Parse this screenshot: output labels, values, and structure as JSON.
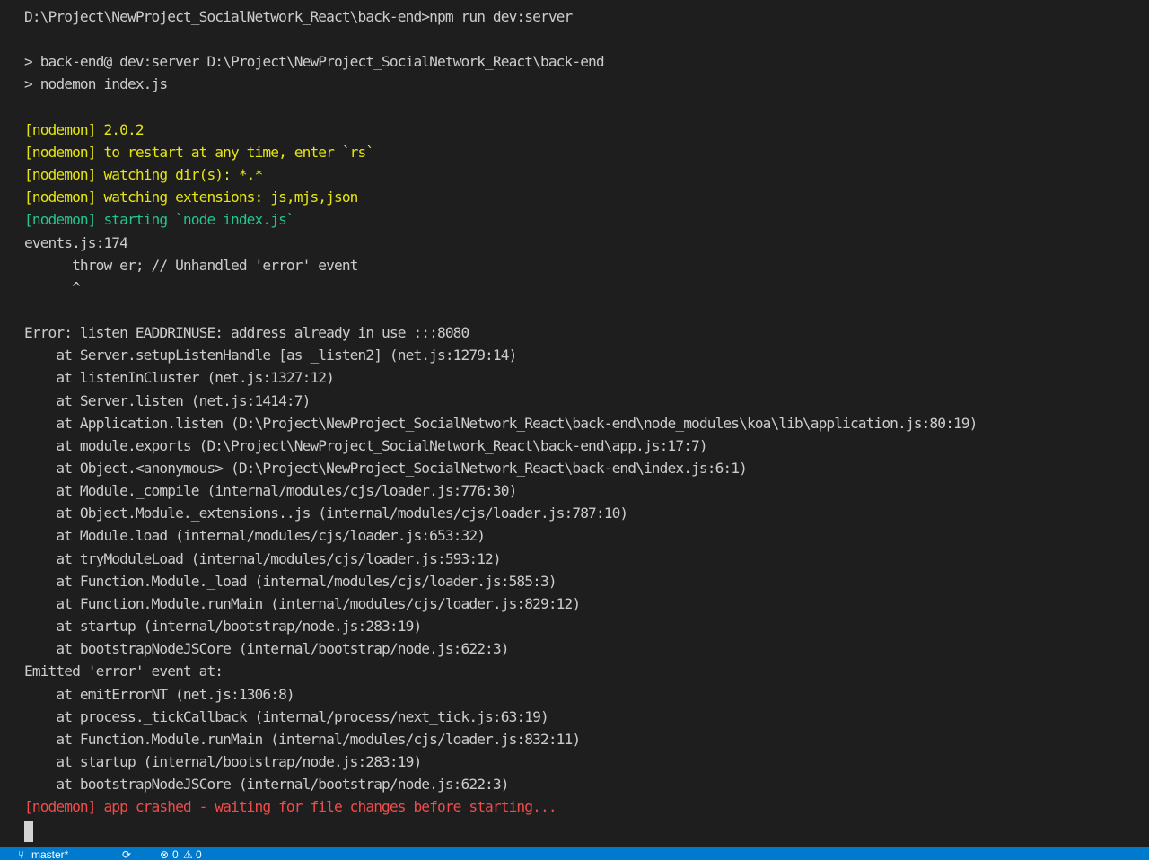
{
  "terminal": {
    "lines": [
      {
        "text": "D:\\Project\\NewProject_SocialNetwork_React\\back-end>npm run dev:server",
        "color": "default"
      },
      {
        "text": "",
        "color": "default"
      },
      {
        "text": "> back-end@ dev:server D:\\Project\\NewProject_SocialNetwork_React\\back-end",
        "color": "default"
      },
      {
        "text": "> nodemon index.js",
        "color": "default"
      },
      {
        "text": "",
        "color": "default"
      },
      {
        "text": "[nodemon] 2.0.2",
        "color": "yellow"
      },
      {
        "text": "[nodemon] to restart at any time, enter `rs`",
        "color": "yellow"
      },
      {
        "text": "[nodemon] watching dir(s): *.*",
        "color": "yellow"
      },
      {
        "text": "[nodemon] watching extensions: js,mjs,json",
        "color": "yellow"
      },
      {
        "text": "[nodemon] starting `node index.js`",
        "color": "green"
      },
      {
        "text": "events.js:174",
        "color": "default"
      },
      {
        "text": "      throw er; // Unhandled 'error' event",
        "color": "default"
      },
      {
        "text": "      ^",
        "color": "default"
      },
      {
        "text": "",
        "color": "default"
      },
      {
        "text": "Error: listen EADDRINUSE: address already in use :::8080",
        "color": "default"
      },
      {
        "text": "    at Server.setupListenHandle [as _listen2] (net.js:1279:14)",
        "color": "default"
      },
      {
        "text": "    at listenInCluster (net.js:1327:12)",
        "color": "default"
      },
      {
        "text": "    at Server.listen (net.js:1414:7)",
        "color": "default"
      },
      {
        "text": "    at Application.listen (D:\\Project\\NewProject_SocialNetwork_React\\back-end\\node_modules\\koa\\lib\\application.js:80:19)",
        "color": "default"
      },
      {
        "text": "    at module.exports (D:\\Project\\NewProject_SocialNetwork_React\\back-end\\app.js:17:7)",
        "color": "default"
      },
      {
        "text": "    at Object.<anonymous> (D:\\Project\\NewProject_SocialNetwork_React\\back-end\\index.js:6:1)",
        "color": "default"
      },
      {
        "text": "    at Module._compile (internal/modules/cjs/loader.js:776:30)",
        "color": "default"
      },
      {
        "text": "    at Object.Module._extensions..js (internal/modules/cjs/loader.js:787:10)",
        "color": "default"
      },
      {
        "text": "    at Module.load (internal/modules/cjs/loader.js:653:32)",
        "color": "default"
      },
      {
        "text": "    at tryModuleLoad (internal/modules/cjs/loader.js:593:12)",
        "color": "default"
      },
      {
        "text": "    at Function.Module._load (internal/modules/cjs/loader.js:585:3)",
        "color": "default"
      },
      {
        "text": "    at Function.Module.runMain (internal/modules/cjs/loader.js:829:12)",
        "color": "default"
      },
      {
        "text": "    at startup (internal/bootstrap/node.js:283:19)",
        "color": "default"
      },
      {
        "text": "    at bootstrapNodeJSCore (internal/bootstrap/node.js:622:3)",
        "color": "default"
      },
      {
        "text": "Emitted 'error' event at:",
        "color": "default"
      },
      {
        "text": "    at emitErrorNT (net.js:1306:8)",
        "color": "default"
      },
      {
        "text": "    at process._tickCallback (internal/process/next_tick.js:63:19)",
        "color": "default"
      },
      {
        "text": "    at Function.Module.runMain (internal/modules/cjs/loader.js:832:11)",
        "color": "default"
      },
      {
        "text": "    at startup (internal/bootstrap/node.js:283:19)",
        "color": "default"
      },
      {
        "text": "    at bootstrapNodeJSCore (internal/bootstrap/node.js:622:3)",
        "color": "default"
      },
      {
        "text": "[nodemon] app crashed - waiting for file changes before starting...",
        "color": "red"
      }
    ]
  },
  "status_bar": {
    "branch_icon": "source-control-branch-icon",
    "branch": "master*",
    "sync_icon": "sync-icon",
    "errors_icon": "error-circle-icon",
    "errors": "0",
    "warnings_icon": "warning-triangle-icon",
    "warnings": "0"
  },
  "colors": {
    "background": "#1e1e1e",
    "text_default": "#cccccc",
    "yellow": "#e5e510",
    "green": "#23c48e",
    "red": "#f14c4c",
    "status_bar": "#007acc"
  }
}
